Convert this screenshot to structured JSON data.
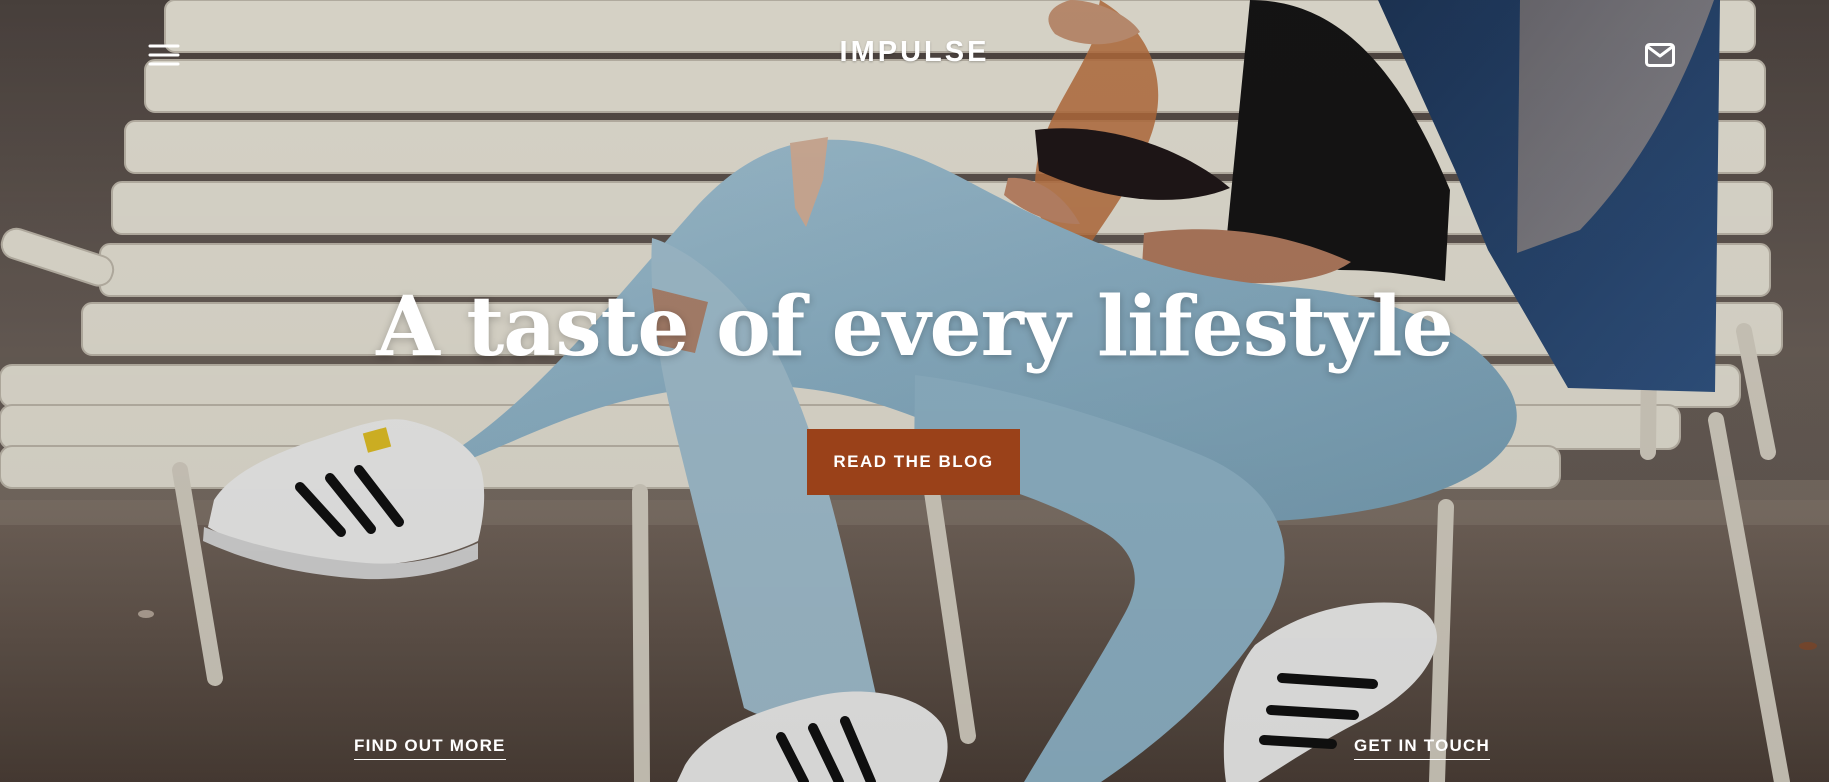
{
  "header": {
    "brand": "IMPULSE",
    "menu_icon": "hamburger-menu-icon",
    "mail_icon": "mail-icon"
  },
  "hero": {
    "headline": "A taste of every lifestyle",
    "cta_label": "READ THE BLOG"
  },
  "footer_links": {
    "left": "FIND OUT MORE",
    "right": "GET IN TOUCH"
  },
  "colors": {
    "cta": "#9a4119",
    "text": "#ffffff",
    "overlay_tint": "#3b302b"
  }
}
